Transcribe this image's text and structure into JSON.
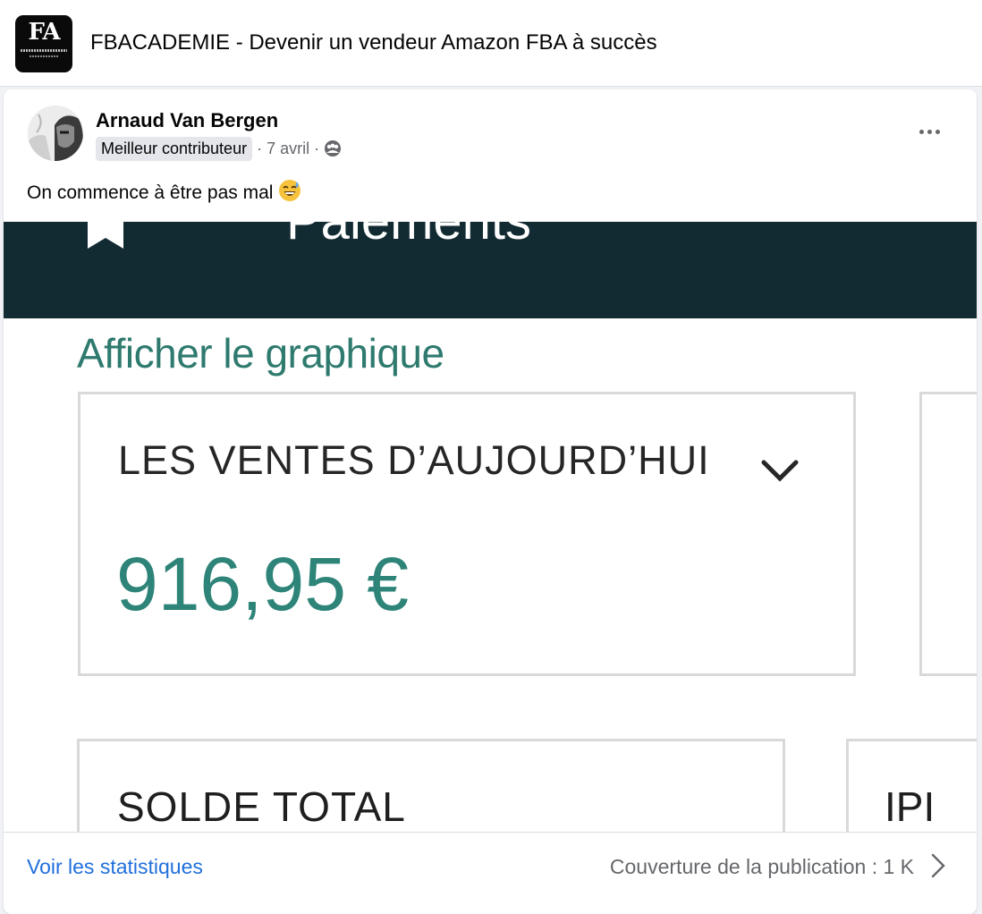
{
  "group": {
    "logo_text": "FA",
    "title": "FBACADEMIE - Devenir un vendeur Amazon FBA à succès"
  },
  "post": {
    "author": "Arnaud Van Bergen",
    "badge": "Meilleur contributeur",
    "separator": "·",
    "date": "7 avril",
    "audience_icon": "group-audience-icon",
    "more_icon": "more-options-icon",
    "text": "On commence à être pas mal",
    "emoji": "😅"
  },
  "screenshot": {
    "header_icon": "bookmark-icon",
    "header_label": "Paiements",
    "graph_link": "Afficher le graphique",
    "sales_label": "LES VENTES D’AUJOURD’HUI",
    "sales_value": "916,95 €",
    "balance_label": "SOLDE TOTAL",
    "ipi_label": "IPI",
    "colors": {
      "header_bg": "#122b33",
      "accent_teal": "#2e8478"
    }
  },
  "footer": {
    "stats_link": "Voir les statistiques",
    "reach_text": "Couverture de la publication : 1 K",
    "chevron_icon": "chevron-right-icon",
    "link_color": "#216fdb"
  }
}
